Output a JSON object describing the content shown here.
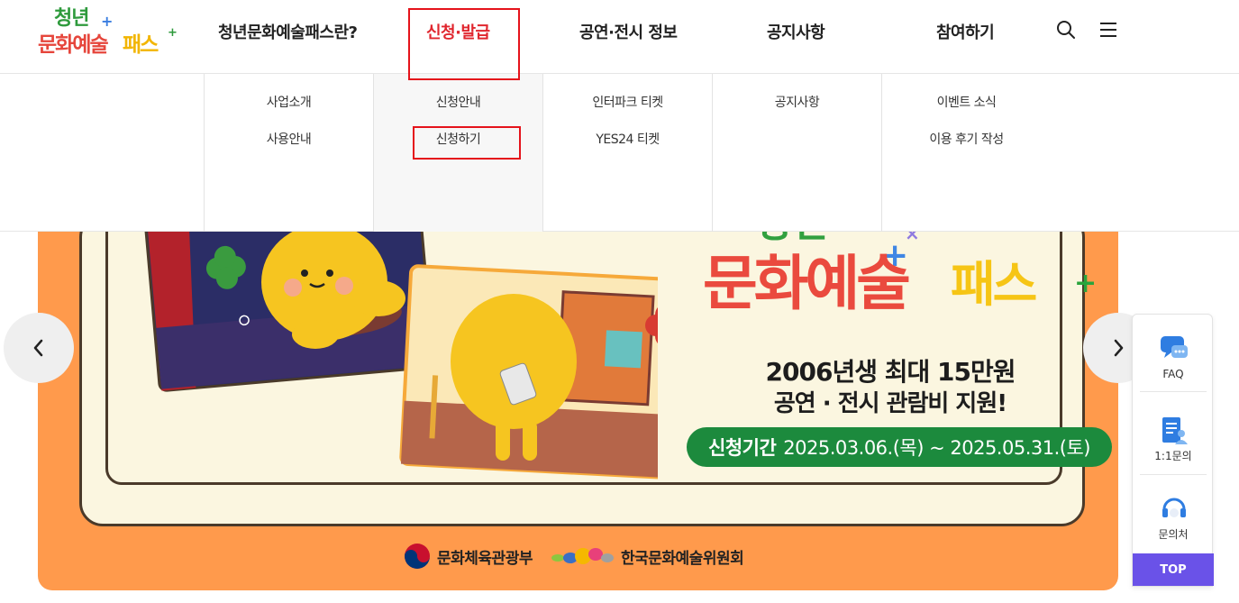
{
  "logo": {
    "line1": "청년",
    "line2": "문화예술",
    "line3": "패스"
  },
  "nav": {
    "items": [
      {
        "label": "청년문화예술패스란?"
      },
      {
        "label": "신청·발급"
      },
      {
        "label": "공연·전시 정보"
      },
      {
        "label": "공지사항"
      },
      {
        "label": "참여하기"
      }
    ],
    "active_index": 1
  },
  "icons": {
    "search": "search-icon",
    "menu": "menu-icon"
  },
  "dropdown": {
    "columns": [
      {
        "links": [
          "사업소개",
          "사용안내"
        ]
      },
      {
        "links": [
          "신청안내",
          "신청하기"
        ]
      },
      {
        "links": [
          "인터파크 티켓",
          "YES24 티켓"
        ]
      },
      {
        "links": [
          "공지사항"
        ]
      },
      {
        "links": [
          "이벤트 소식",
          "이용 후기 작성"
        ]
      }
    ]
  },
  "banner": {
    "title_top": "청년",
    "title_main": "문화예술",
    "title_pass": "패스",
    "headline1": "2006년생 최대 15만원",
    "headline2": "공연 · 전시 관람비 지원!",
    "period_label": "신청기간",
    "period_value": "2025.03.06.(목) ~ 2025.05.31.(토)",
    "sponsor1": "문화체육관광부",
    "sponsor2": "한국문화예술위원회"
  },
  "quick_menu": {
    "items": [
      {
        "label": "FAQ",
        "icon": "chat-bubble-icon"
      },
      {
        "label": "1:1문의",
        "icon": "document-person-icon"
      },
      {
        "label": "문의처",
        "icon": "headset-icon"
      }
    ],
    "top_label": "TOP"
  },
  "colors": {
    "accent_red": "#e0262e",
    "banner_orange": "#ff9a4c",
    "period_green": "#1c8a3d",
    "top_purple": "#6a52e8",
    "highlight_box": "#e5131b"
  }
}
